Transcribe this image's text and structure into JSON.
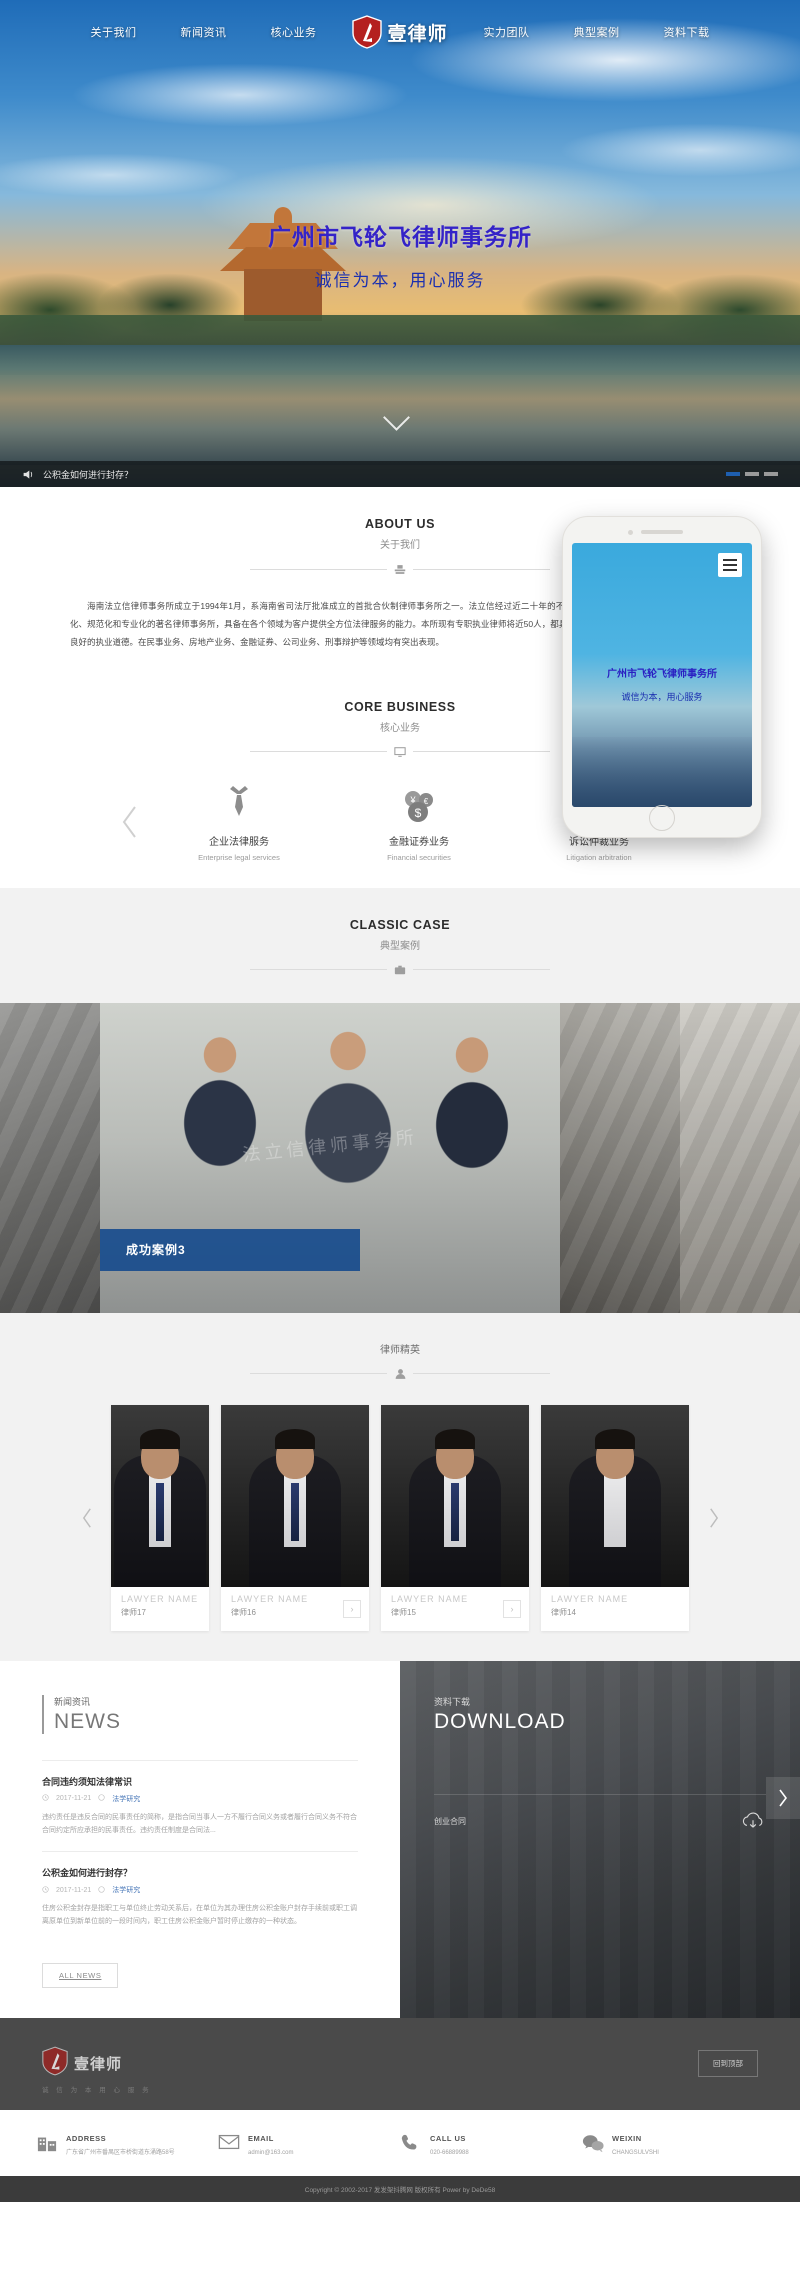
{
  "nav": {
    "left_items": [
      {
        "label": "关于我们",
        "name": "nav-about"
      },
      {
        "label": "新闻资讯",
        "name": "nav-news"
      },
      {
        "label": "核心业务",
        "name": "nav-business"
      }
    ],
    "right_items": [
      {
        "label": "实力团队",
        "name": "nav-team"
      },
      {
        "label": "典型案例",
        "name": "nav-case"
      },
      {
        "label": "资料下载",
        "name": "nav-download"
      }
    ],
    "logo_text": "壹律师"
  },
  "hero": {
    "title": "广州市飞轮飞律师事务所",
    "subtitle": "诚信为本，用心服务",
    "ticker": "公积金如何进行封存？",
    "dots": [
      "on",
      "off",
      "off"
    ]
  },
  "about": {
    "en": "ABOUT US",
    "cn": "关于我们",
    "body": "海南法立信律师事务所成立于1994年1月，系海南省司法厅批准成立的首批合伙制律师事务所之一。法立信经过近二十年的不懈努力，已发展成为海南省屈指可数的规模化、规范化和专业化的著名律师事务所，具备在各个领域为客户提供全方位法律服务的能力。本所现有专职执业律师将近50人，都具有较高的法学理论水平、丰富的从业经验和良好的执业道德。在民事业务、房地产业务、金融证券、公司业务、刑事辩护等领域均有突出表现。"
  },
  "core": {
    "en": "CORE BUSINESS",
    "cn": "核心业务",
    "items": [
      {
        "title": "企业法律服务",
        "sub": "Enterprise legal services",
        "icon": "tie-icon"
      },
      {
        "title": "金融证券业务",
        "sub": "Financial securities",
        "icon": "coins-icon"
      },
      {
        "title": "诉讼仲裁业务",
        "sub": "Litigation arbitration",
        "icon": "badge-icon"
      }
    ]
  },
  "phone": {
    "title": "广州市飞轮飞律师事务所",
    "subtitle": "诚信为本，用心服务"
  },
  "case": {
    "en": "CLASSIC CASE",
    "cn": "典型案例",
    "caption": "成功案例3",
    "watermark": "法立信律师事务所"
  },
  "lawyers": {
    "cn": "律师精英",
    "cards": [
      {
        "en": "LAWYER NAME",
        "cn": "律师17"
      },
      {
        "en": "LAWYER NAME",
        "cn": "律师16"
      },
      {
        "en": "LAWYER NAME",
        "cn": "律师15"
      },
      {
        "en": "LAWYER NAME",
        "cn": "律师14"
      }
    ]
  },
  "news": {
    "cn": "新闻资讯",
    "en": "NEWS",
    "all_label": "ALL NEWS",
    "items": [
      {
        "title": "合同违约须知法律常识",
        "date": "2017-11-21",
        "category": "法学研究",
        "desc": "违约责任是违反合同的民事责任的简称，是指合同当事人一方不履行合同义务或者履行合同义务不符合合同约定所应承担的民事责任。违约责任制度是合同法..."
      },
      {
        "title": "公积金如何进行封存？",
        "date": "2017-11-21",
        "category": "法学研究",
        "desc": "住房公积金封存是指职工与单位终止劳动关系后，在单位为其办理住房公积金账户封存手续前或职工调离原单位到新单位前的一段时间内，职工住房公积金账户暂时停止缴存的一种状态。"
      }
    ]
  },
  "download": {
    "cn": "资料下载",
    "en": "DOWNLOAD",
    "item_name": "创业合同",
    "icon": "cloud-download-icon",
    "next_icon": "chevron-right-icon"
  },
  "footer": {
    "logo_text": "壹律师",
    "sub_text": "诚 信 为 本   用 心 服 务",
    "backtop_label": "回到顶部",
    "contacts": [
      {
        "icon": "building-icon",
        "label": "ADDRESS",
        "value": "广东省广州市番禺区市桥街道东涌路58号"
      },
      {
        "icon": "mail-icon",
        "label": "EMAIL",
        "value": "admin@163.com"
      },
      {
        "icon": "phone-icon",
        "label": "CALL US",
        "value": "020-66889988"
      },
      {
        "icon": "wechat-icon",
        "label": "WEIXIN",
        "value": "CHANGSULVSHI"
      }
    ],
    "copyright": "Copyright © 2002-2017 发发架抖腾网 版权所有 Power by DeDe58"
  },
  "colors": {
    "accent_blue": "#11488c",
    "hero_title": "#3423c8",
    "footer_bg": "#4a4a4a"
  }
}
